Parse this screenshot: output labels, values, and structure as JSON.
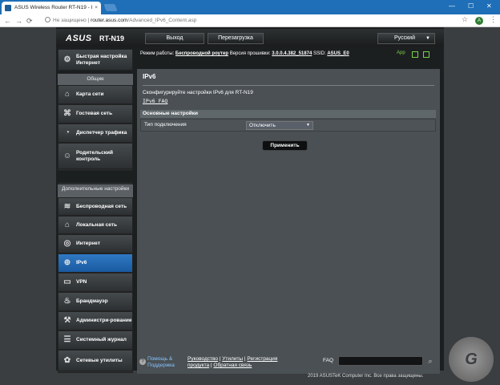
{
  "browser": {
    "tab_title": "ASUS Wireless Router RT-N19 - I",
    "tab_close": "×",
    "address_security": "Не защищено",
    "address_host": "router.asus.com",
    "address_path": "/Advanced_IPv6_Content.asp",
    "profile_initial": "A",
    "window_controls": [
      "—",
      "☐",
      "✕"
    ]
  },
  "router": {
    "logo": "ASUS",
    "model": "RT-N19",
    "logout_label": "Выход",
    "reboot_label": "Перезагрузка",
    "language": "Русский",
    "status": {
      "mode_label": "Режим работы:",
      "mode_value": "Беспроводной роутер",
      "firmware_label": "Версия прошивки:",
      "firmware_value": "3.0.0.4.382_51874",
      "ssid_label": "SSID:",
      "ssid_value": "ASUS_E0",
      "app_label": "App"
    },
    "sidebar": {
      "quick_setup": "Быстрая настройка Интернет",
      "general_header": "Общие",
      "general_items": [
        {
          "label": "Карта сети",
          "icon": "network-map-icon"
        },
        {
          "label": "Гостевая сеть",
          "icon": "guest-network-icon"
        },
        {
          "label": "Диспетчер трафика",
          "icon": "traffic-manager-icon"
        },
        {
          "label": "Родительский контроль",
          "icon": "parental-control-icon"
        }
      ],
      "advanced_header": "Дополнительные настройки",
      "advanced_items": [
        {
          "label": "Беспроводная сеть",
          "icon": "wireless-icon"
        },
        {
          "label": "Локальная сеть",
          "icon": "lan-icon"
        },
        {
          "label": "Интернет",
          "icon": "wan-icon"
        },
        {
          "label": "IPv6",
          "icon": "ipv6-icon"
        },
        {
          "label": "VPN",
          "icon": "vpn-icon"
        },
        {
          "label": "Брандмауэр",
          "icon": "firewall-icon"
        },
        {
          "label": "Администри-рование",
          "icon": "administration-icon"
        },
        {
          "label": "Системный журнал",
          "icon": "system-log-icon"
        },
        {
          "label": "Сетевые утилиты",
          "icon": "network-tools-icon"
        }
      ]
    },
    "page": {
      "title": "IPv6",
      "description": "Сконфигурируйте настройки IPv6 для RT-N19",
      "faq_link": "IPv6 FAQ",
      "section_title": "Основные настройки",
      "connection_type_label": "Тип подключения",
      "connection_type_value": "Отключить",
      "apply_label": "Применить"
    },
    "footer": {
      "help_label": "Помощь & Поддержка",
      "manual": "Руководство",
      "utilities": "Утилиты",
      "registration": "Регистрация продукта",
      "feedback": "Обратная связь",
      "faq_label": "FAQ",
      "copyright": "2019 ASUSTeK Computer Inc. Все права защищены."
    }
  }
}
